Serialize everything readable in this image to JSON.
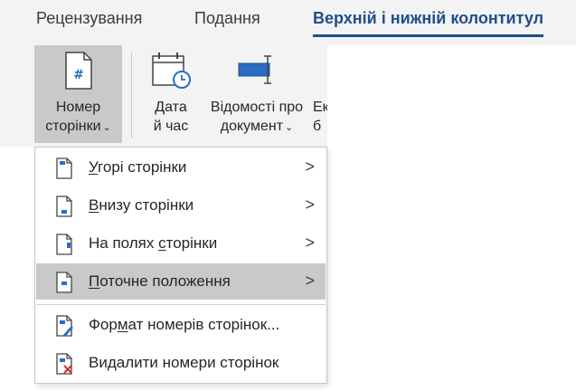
{
  "tabs": [
    {
      "label": "Рецензування"
    },
    {
      "label": "Подання"
    },
    {
      "label": "Верхній і нижній колонтитул"
    }
  ],
  "ribbon": {
    "page_number": {
      "line1": "Номер",
      "line2": "сторінки",
      "chevron": "⌄"
    },
    "date_time": {
      "line1": "Дата",
      "line2": "й час"
    },
    "doc_info": {
      "line1": "Відомості про",
      "line2": "документ",
      "chevron": "⌄"
    },
    "quick_parts": {
      "line1": "Ек",
      "line2": "б"
    }
  },
  "menu": {
    "items": [
      {
        "pre": "",
        "ul": "У",
        "post": "горі сторінки",
        "submenu": true,
        "icon": "page-top-number-icon"
      },
      {
        "pre": "",
        "ul": "В",
        "post": "низу сторінки",
        "submenu": true,
        "icon": "page-bottom-number-icon"
      },
      {
        "pre": "На полях ",
        "ul": "с",
        "post": "торінки",
        "submenu": true,
        "icon": "page-margin-number-icon"
      },
      {
        "pre": "",
        "ul": "П",
        "post": "оточне положення",
        "submenu": true,
        "icon": "current-position-icon",
        "highlighted": true
      },
      {
        "pre": "Фор",
        "ul": "м",
        "post": "ат номерів сторінок...",
        "submenu": false,
        "icon": "format-page-numbers-icon"
      },
      {
        "pre": "",
        "ul": "",
        "post": "Видалити номери сторінок",
        "submenu": false,
        "icon": "remove-page-numbers-icon"
      }
    ],
    "arrow_glyph": ">"
  },
  "colors": {
    "accent": "#1f4e8c",
    "ribbon_bg": "#f3f3f3",
    "hover_bg": "#c9c9c9",
    "icon_blue": "#2b6cc4",
    "remove_red": "#d13438"
  }
}
